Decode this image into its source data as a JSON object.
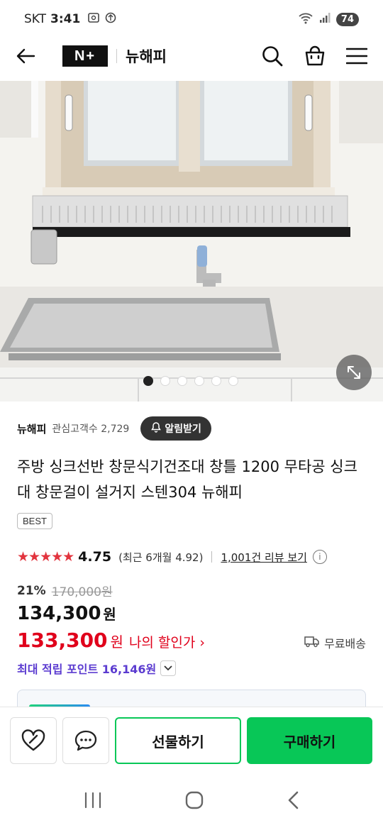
{
  "status": {
    "carrier": "SKT",
    "time": "3:41",
    "battery": "74",
    "icons": [
      "screenshot-icon",
      "data-saver-icon",
      "wifi-icon",
      "signal-icon"
    ]
  },
  "header": {
    "logo": "N+",
    "store_name": "뉴해피",
    "icons": [
      "back-arrow-icon",
      "search-icon",
      "shopping-bag-icon",
      "menu-icon"
    ]
  },
  "gallery": {
    "image_count": 6,
    "active_index": 0
  },
  "seller": {
    "name": "뉴해피",
    "followers": "관심고객수 2,729",
    "alarm_label": "알림받기"
  },
  "product": {
    "title": "주방 싱크선반 창문식기건조대 창틀 1200 무타공 싱크대 창문걸이 설거지 스텐304 뉴해피",
    "badge": "BEST"
  },
  "rating": {
    "stars": "★★★★★",
    "score": "4.75",
    "recent": "(최근 6개월 4.92)",
    "review_link": "1,001건 리뷰 보기",
    "info": "i"
  },
  "pricing": {
    "discount_rate": "21%",
    "original_price": "170,000원",
    "price": "134,300",
    "price_unit": "원",
    "my_price": "133,300",
    "my_price_unit": "원",
    "my_price_label": "나의 할인가 ›",
    "shipping": "무료배송",
    "points": "최대 적립 포인트 16,146원"
  },
  "actions": {
    "gift_label": "선물하기",
    "buy_label": "구매하기"
  },
  "colors": {
    "accent_green": "#08c757",
    "price_red": "#e0001b",
    "points_purple": "#5b3bd0",
    "star_red": "#e2343e"
  }
}
